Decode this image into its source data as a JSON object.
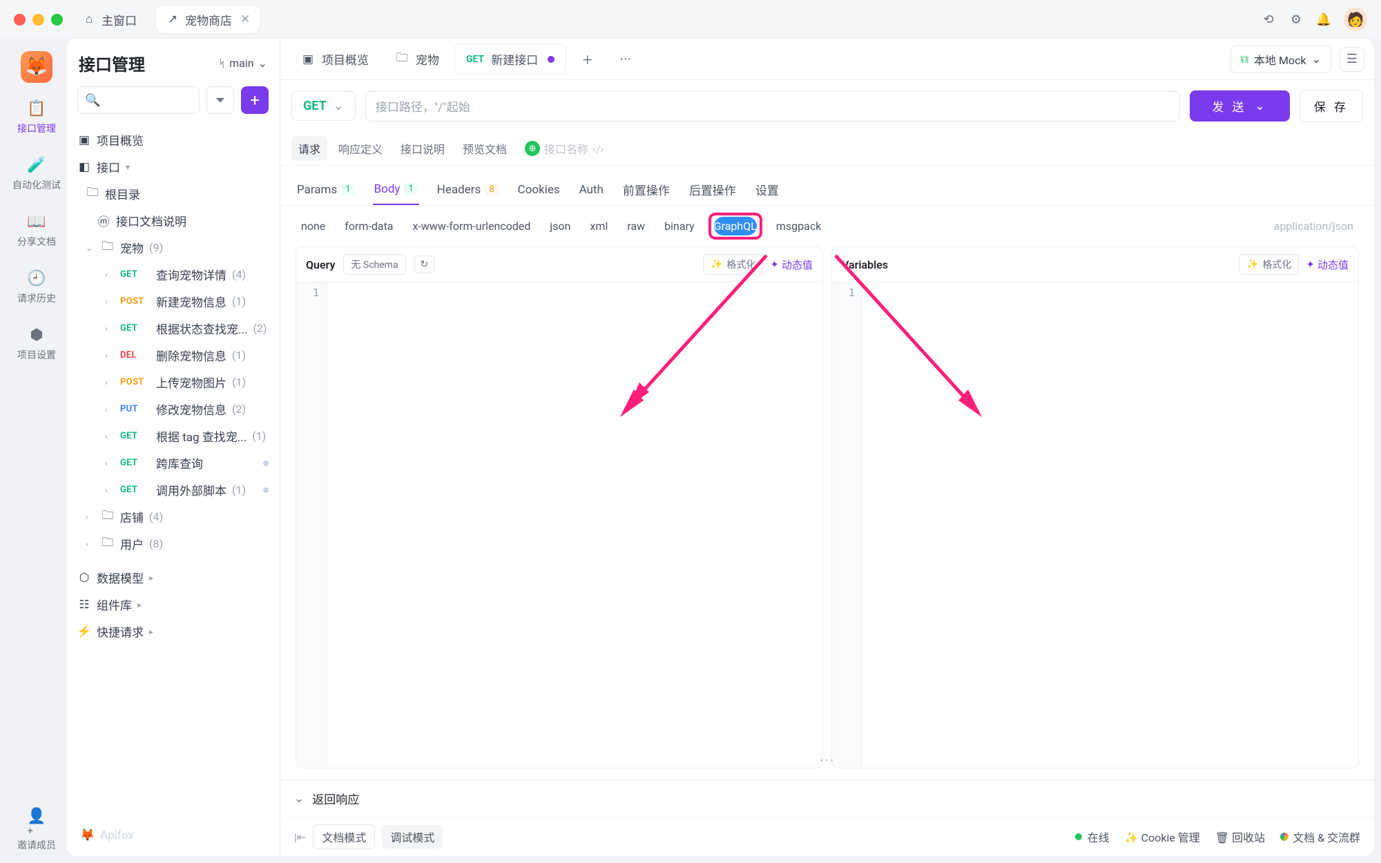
{
  "titlebar": {
    "main_window": "主窗口",
    "tab_name": "宠物商店"
  },
  "rail": {
    "api_mgmt": "接口管理",
    "auto_test": "自动化测试",
    "share_docs": "分享文档",
    "req_history": "请求历史",
    "project_settings": "项目设置",
    "invite": "邀请成员"
  },
  "sidebar": {
    "title": "接口管理",
    "branch": "main",
    "project_overview": "项目概览",
    "interface": "接口",
    "root": "根目录",
    "doc_desc": "接口文档说明",
    "folders": {
      "pet": {
        "name": "宠物",
        "count": "(9)"
      },
      "store": {
        "name": "店铺",
        "count": "(4)"
      },
      "user": {
        "name": "用户",
        "count": "(8)"
      }
    },
    "endpoints": [
      {
        "m": "GET",
        "cls": "mget",
        "name": "查询宠物详情",
        "cnt": "(4)"
      },
      {
        "m": "POST",
        "cls": "mpost",
        "name": "新建宠物信息",
        "cnt": "(1)"
      },
      {
        "m": "GET",
        "cls": "mget",
        "name": "根据状态查找宠...",
        "cnt": "(2)"
      },
      {
        "m": "DEL",
        "cls": "mdel",
        "name": "删除宠物信息",
        "cnt": "(1)"
      },
      {
        "m": "POST",
        "cls": "mpost",
        "name": "上传宠物图片",
        "cnt": "(1)"
      },
      {
        "m": "PUT",
        "cls": "mput",
        "name": "修改宠物信息",
        "cnt": "(2)"
      },
      {
        "m": "GET",
        "cls": "mget",
        "name": "根据 tag 查找宠...",
        "cnt": "(1)"
      },
      {
        "m": "GET",
        "cls": "mget",
        "name": "跨库查询",
        "cnt": "",
        "dot": true
      },
      {
        "m": "GET",
        "cls": "mget",
        "name": "调用外部脚本",
        "cnt": "(1)",
        "dot": true
      }
    ],
    "data_model": "数据模型",
    "component_lib": "组件库",
    "quick_request": "快捷请求",
    "brand": "Apifox"
  },
  "main": {
    "tabs": {
      "overview": "项目概览",
      "pet": "宠物",
      "new_if": "新建接口",
      "new_if_method": "GET"
    },
    "env": "本地 Mock",
    "method": "GET",
    "url_placeholder": "接口路径，\"/\"起始",
    "send": "发 送",
    "save": "保 存",
    "sub": {
      "req": "请求",
      "resp_def": "响应定义",
      "if_desc": "接口说明",
      "preview": "预览文档",
      "name_ph": "接口名称"
    },
    "rtabs": {
      "params": "Params",
      "params_badge": "1",
      "body": "Body",
      "body_badge": "1",
      "headers": "Headers",
      "headers_badge": "8",
      "cookies": "Cookies",
      "auth": "Auth",
      "pre": "前置操作",
      "post": "后置操作",
      "settings": "设置"
    },
    "bodytypes": {
      "none": "none",
      "form": "form-data",
      "xwww": "x-www-form-urlencoded",
      "json": "json",
      "xml": "xml",
      "raw": "raw",
      "binary": "binary",
      "graphql": "GraphQL",
      "msgpack": "msgpack",
      "mime": "application/json"
    },
    "editor": {
      "query": "Query",
      "no_schema": "无 Schema",
      "format": "格式化",
      "dynamic": "动态值",
      "variables": "Variables"
    },
    "response": {
      "title": "返回响应"
    },
    "status": {
      "doc_mode": "文档模式",
      "debug_mode": "调试模式",
      "online": "在线",
      "cookie": "Cookie 管理",
      "trash": "回收站",
      "docs": "文档 & 交流群"
    }
  }
}
